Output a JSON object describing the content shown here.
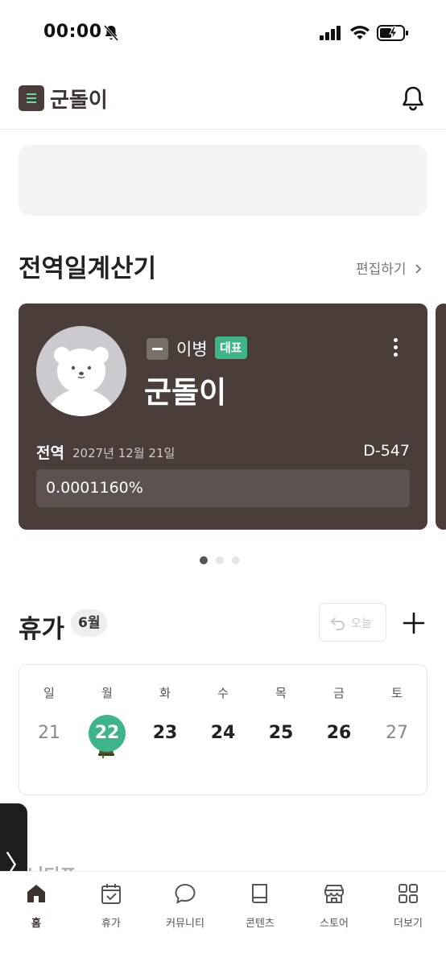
{
  "status_bar": {
    "time": "00:00",
    "icons": [
      "bell-off-icon",
      "signal-icon",
      "wifi-icon",
      "battery-charging-icon"
    ]
  },
  "header": {
    "app_name": "군돌이",
    "logo_icon": "menu-logo-icon",
    "notification_icon": "bell-icon"
  },
  "discharge_section": {
    "title": "전역일계산기",
    "edit_label": "편집하기",
    "card": {
      "rank_symbol": "—",
      "rank": "이병",
      "representative_tag": "대표",
      "name": "군돌이",
      "discharge_label": "전역",
      "discharge_date": "2027년 12월 21일",
      "d_day": "D-547",
      "progress_text": "0.0001160%",
      "progress_percent": 0.000116
    },
    "pager": {
      "count": 3,
      "active": 0
    }
  },
  "vacation_section": {
    "title": "휴가",
    "month": "6월",
    "today_button": "오늘",
    "weekdays": [
      "일",
      "월",
      "화",
      "수",
      "목",
      "금",
      "토"
    ],
    "dates": [
      "21",
      "22",
      "23",
      "24",
      "25",
      "26",
      "27"
    ],
    "selected_index": 1,
    "event_icon": "military-helmet-icon"
  },
  "next_section_title": "니티포",
  "side_handle": "〉",
  "tabs": [
    {
      "label": "홈",
      "icon": "home-icon",
      "active": true
    },
    {
      "label": "휴가",
      "icon": "calendar-check-icon",
      "active": false
    },
    {
      "label": "커뮤니티",
      "icon": "chat-bubble-icon",
      "active": false
    },
    {
      "label": "콘텐츠",
      "icon": "book-icon",
      "active": false
    },
    {
      "label": "스토어",
      "icon": "store-icon",
      "active": false
    },
    {
      "label": "더보기",
      "icon": "grid-icon",
      "active": false
    }
  ],
  "colors": {
    "accent": "#3db489",
    "card": "#4a3d3a",
    "brand_dark": "#3c3330"
  }
}
